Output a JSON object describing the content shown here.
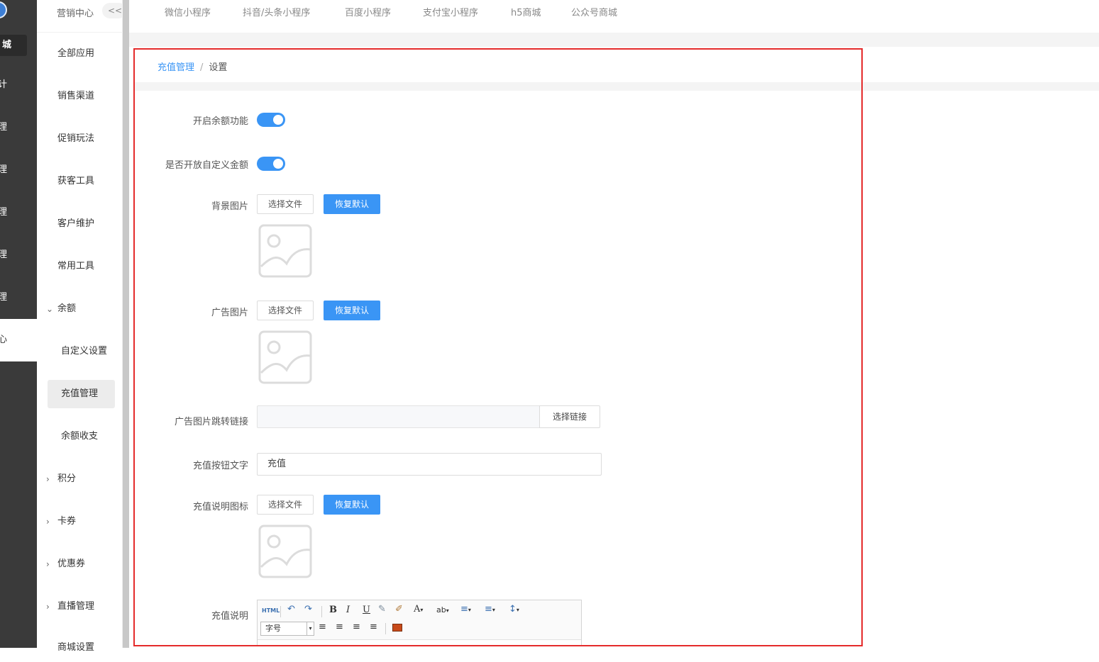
{
  "left_nav": {
    "items": [
      "城",
      "计",
      "理",
      "理",
      "理",
      "理",
      "理",
      "心"
    ]
  },
  "sub_nav": {
    "title": "营销中心",
    "collapse": "<<",
    "items": [
      "全部应用",
      "销售渠道",
      "促销玩法",
      "获客工具",
      "客户维护",
      "常用工具"
    ],
    "group_open": "余额",
    "group_items": [
      "自定义设置",
      "充值管理",
      "余额收支"
    ],
    "groups_closed": [
      "积分",
      "卡券",
      "优惠券",
      "直播管理",
      "商城设置"
    ]
  },
  "top_tabs": [
    "微信小程序",
    "抖音/头条小程序",
    "百度小程序",
    "支付宝小程序",
    "h5商城",
    "公众号商城"
  ],
  "breadcrumb": {
    "parent": "充值管理",
    "separator": "/",
    "current": "设置"
  },
  "form": {
    "enable_balance_label": "开启余额功能",
    "enable_balance": true,
    "custom_amount_label": "是否开放自定义金额",
    "custom_amount": true,
    "bg_image_label": "背景图片",
    "ad_image_label": "广告图片",
    "ad_link_label": "广告图片跳转链接",
    "ad_link_value": "",
    "select_link": "选择链接",
    "btn_text_label": "充值按钮文字",
    "btn_text_value": "充值",
    "desc_icon_label": "充值说明图标",
    "desc_label": "充值说明",
    "choose_file": "选择文件",
    "restore_default": "恢复默认"
  },
  "editor": {
    "html_label": "HTML",
    "font_size_placeholder": "字号"
  },
  "colors": {
    "primary": "#3a95f5",
    "highlight_border": "#e42b2b",
    "dark_nav": "#3a3a3a"
  }
}
